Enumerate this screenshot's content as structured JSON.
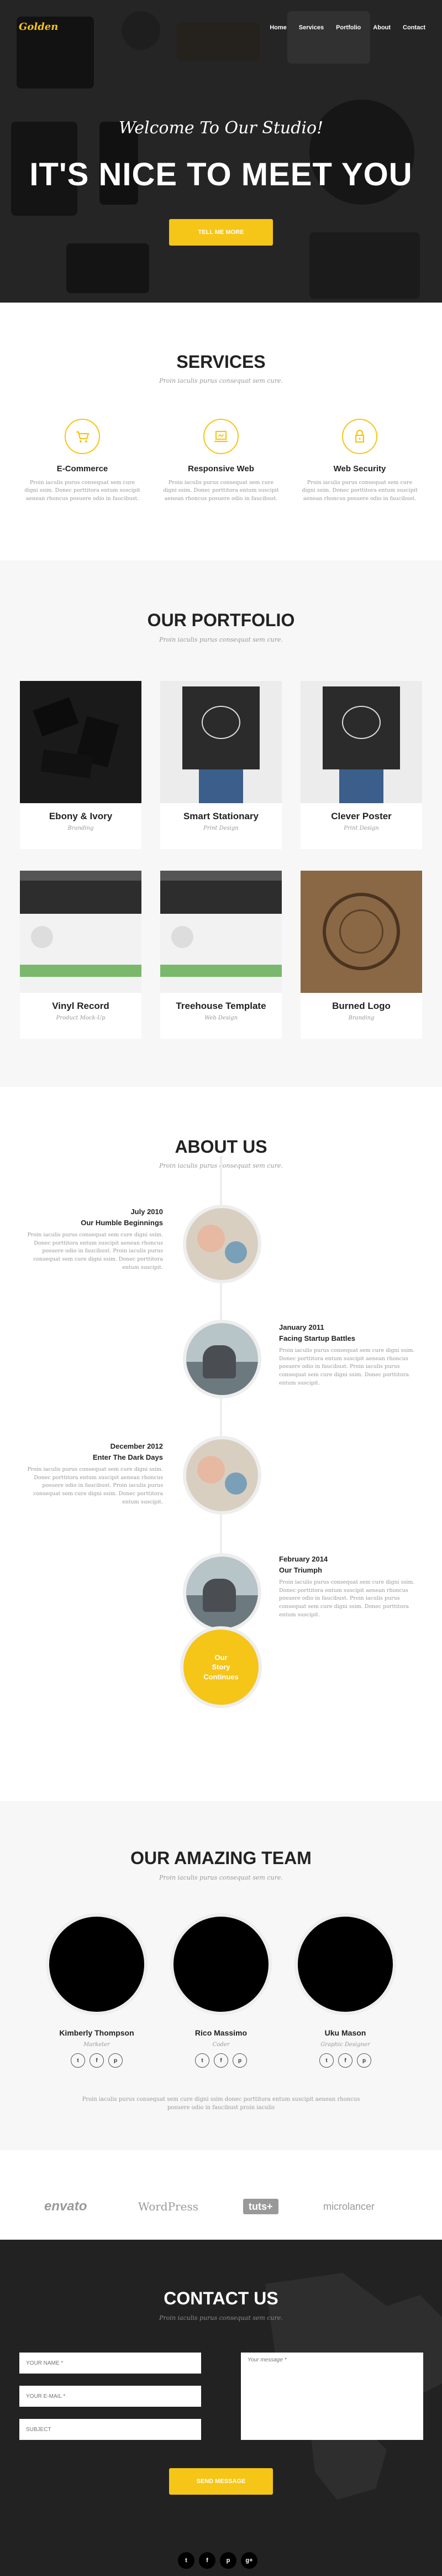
{
  "brand": "Golden",
  "nav": [
    "Home",
    "Services",
    "Portfolio",
    "About",
    "Contact"
  ],
  "hero": {
    "subtitle": "Welcome To Our Studio!",
    "title": "IT'S NICE TO MEET YOU",
    "button": "TELL ME MORE"
  },
  "services": {
    "title": "SERVICES",
    "subtitle": "Proin iaculis purus consequat sem cure.",
    "items": [
      {
        "icon": "shopping-cart-icon",
        "title": "E-Commerce",
        "text": "Proin iaculis purus consequat sem cure digni ssim. Donec porttitora entum suscipit aenean rhoncus posuere odio in faucibust."
      },
      {
        "icon": "laptop-icon",
        "title": "Responsive Web",
        "text": "Proin iaculis purus consequat sem cure digni ssim. Donec porttitora entum suscipit aenean rhoncus posuere odio in faucibust."
      },
      {
        "icon": "lock-icon",
        "title": "Web Security",
        "text": "Proin iaculis purus consequat sem cure digni ssim. Donec porttitora entum suscipit aenean rhoncus posuere odio in faucibust."
      }
    ]
  },
  "portfolio": {
    "title": "OUR PORTFOLIO",
    "subtitle": "Proin iaculis purus consequat sem cure.",
    "items": [
      {
        "title": "Ebony & Ivory",
        "category": "Branding"
      },
      {
        "title": "Smart Stationary",
        "category": "Print Design"
      },
      {
        "title": "Clever Poster",
        "category": "Print Design"
      },
      {
        "title": "Vinyl Record",
        "category": "Product Mock-Up"
      },
      {
        "title": "Treehouse Template",
        "category": "Web Design"
      },
      {
        "title": "Burned Logo",
        "category": "Branding"
      }
    ]
  },
  "about": {
    "title": "ABOUT US",
    "subtitle": "Proin iaculis purus consequat sem cure.",
    "timeline": [
      {
        "date": "July 2010",
        "title": "Our Humble Beginnings",
        "text": "Proin iaculis purus consequat sem cure digni ssim. Donec porttitora entum suscipit aenean rhoncus posuere odio in faucibust. Proin iaculis purus consequat sem cure digni ssim. Donec porttitora entum suscipit."
      },
      {
        "date": "January 2011",
        "title": "Facing Startup Battles",
        "text": "Proin iaculis purus consequat sem cure digni ssim. Donec porttitora entum suscipit aenean rhoncus posuere odio in faucibust. Proin iaculis purus consequat sem cure digni ssim. Donec porttitora entum suscipit."
      },
      {
        "date": "December 2012",
        "title": "Enter The Dark Days",
        "text": "Proin iaculis purus consequat sem cure digni ssim. Donec porttitora entum suscipit aenean rhoncus posuere odio in faucibust. Proin iaculis purus consequat sem cure digni ssim. Donec porttitora entum suscipit."
      },
      {
        "date": "February 2014",
        "title": "Our Triumph",
        "text": "Proin iaculis purus consequat sem cure digni ssim. Donec porttitora entum suscipit aenean rhoncus posuere odio in faucibust. Proin iaculis purus consequat sem cure digni ssim. Donec porttitora entum suscipit."
      }
    ],
    "story": [
      "Our",
      "Story",
      "Continues"
    ]
  },
  "team": {
    "title": "OUR AMAZING TEAM",
    "subtitle": "Proin iaculis purus consequat sem cure.",
    "members": [
      {
        "name": "Kimberly Thompson",
        "role": "Marketer"
      },
      {
        "name": "Rico Massimo",
        "role": "Coder"
      },
      {
        "name": "Uku Mason",
        "role": "Graphic Designer"
      }
    ],
    "social": [
      "t",
      "f",
      "p"
    ],
    "note": "Proin iaculis purus consequat sem cure digni ssim donec porttitora entum suscipit aenean rhoncus posuere odio in faucibust proin iaculis"
  },
  "clients": [
    "envato",
    "WordPress",
    "tuts+",
    "microlancer"
  ],
  "contact": {
    "title": "CONTACT US",
    "subtitle": "Proin iaculis purus consequat sem cure.",
    "name_placeholder": "YOUR NAME *",
    "email_placeholder": "YOUR E-MAIL *",
    "subject_placeholder": "SUBJECT",
    "message_placeholder": "Your message *",
    "button": "SEND MESSAGE"
  },
  "footer_social": [
    "t",
    "f",
    "p",
    "g+"
  ],
  "colors": {
    "accent": "#f5c518",
    "dark": "#222222",
    "light": "#f7f7f7"
  }
}
